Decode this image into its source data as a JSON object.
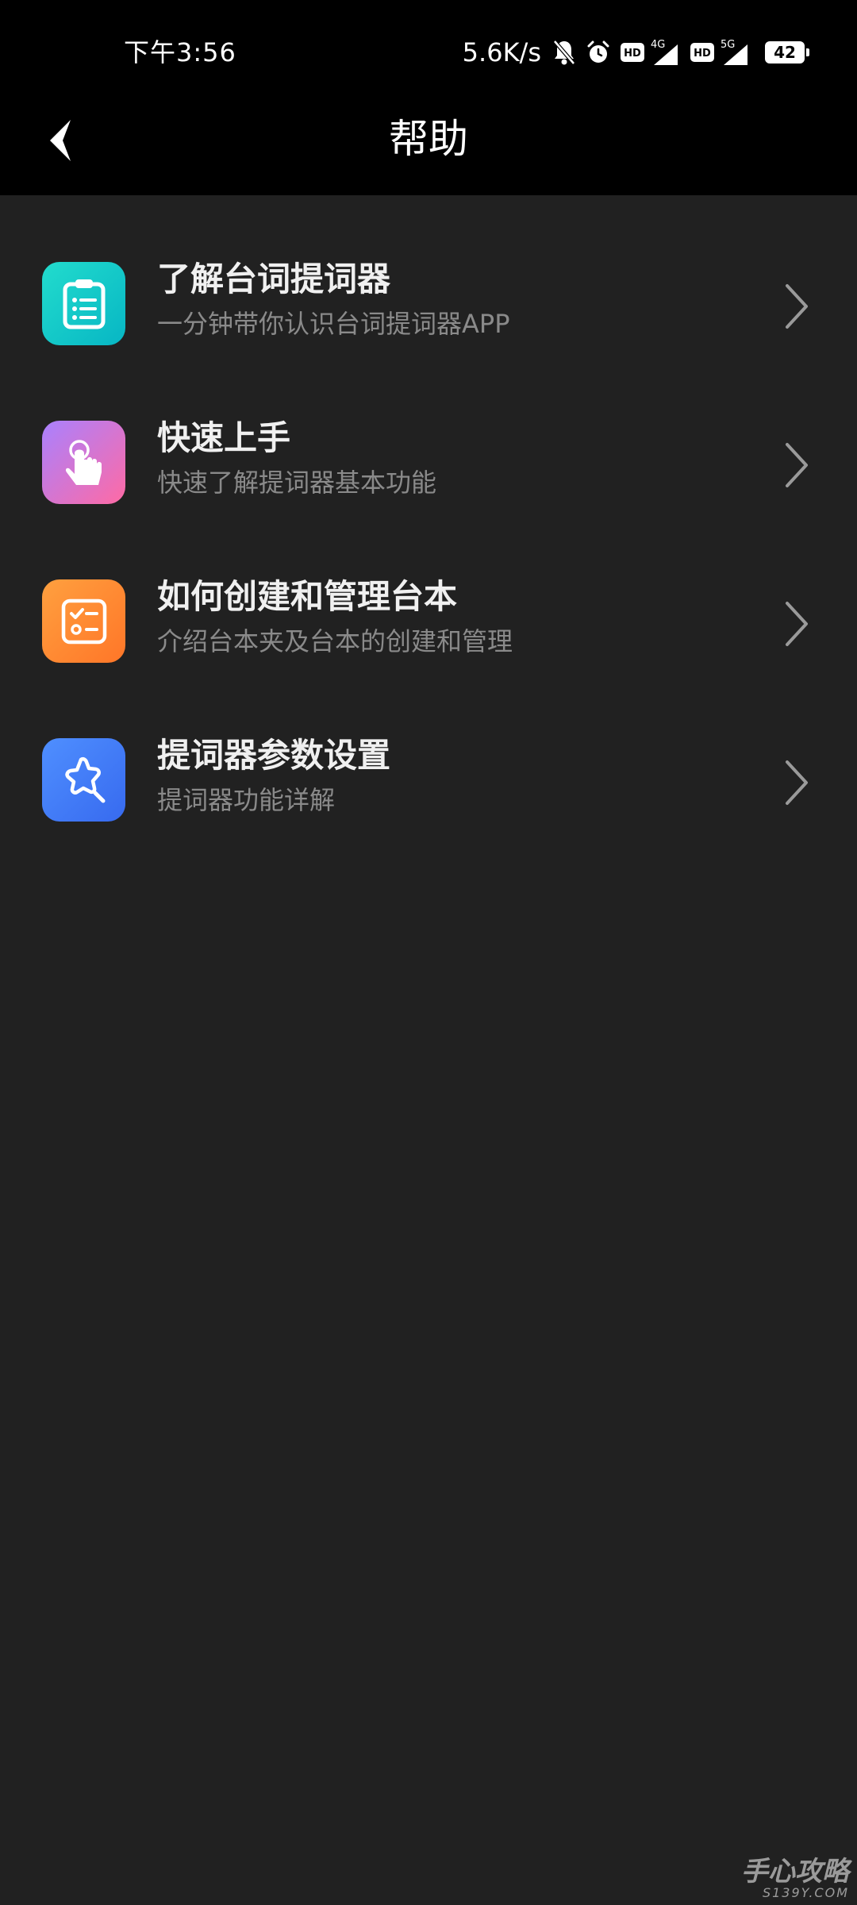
{
  "status_bar": {
    "time": "下午3:56",
    "net_speed": "5.6K/s",
    "icons": [
      "mute-bell-icon",
      "alarm-icon",
      "hd-icon",
      "4g-signal-icon",
      "hd-icon",
      "5g-signal-icon"
    ],
    "signal_1_label": "4G",
    "signal_2_label": "5G",
    "hd_label": "HD",
    "battery": "42"
  },
  "header": {
    "title": "帮助",
    "back_icon": "back-arrow-icon"
  },
  "help_items": [
    {
      "title": "了解台词提词器",
      "description": "一分钟带你认识台词提词器APP",
      "icon": "clipboard-list-icon",
      "color_start": "#1fd6c8",
      "color_end": "#0ab8c2"
    },
    {
      "title": "快速上手",
      "description": "快速了解提词器基本功能",
      "icon": "tap-hand-icon",
      "color_start": "#b07bff",
      "color_end": "#ff6fa8"
    },
    {
      "title": "如何创建和管理台本",
      "description": "介绍台本夹及台本的创建和管理",
      "icon": "checklist-icon",
      "color_start": "#ff9a3c",
      "color_end": "#ff7a2a"
    },
    {
      "title": "提词器参数设置",
      "description": "提词器功能详解",
      "icon": "star-settings-icon",
      "color_start": "#4f8bff",
      "color_end": "#3c6df0"
    }
  ],
  "chevron_icon": "chevron-right-icon",
  "watermark": {
    "text": "手心攻略",
    "sub": "S139Y.COM"
  }
}
